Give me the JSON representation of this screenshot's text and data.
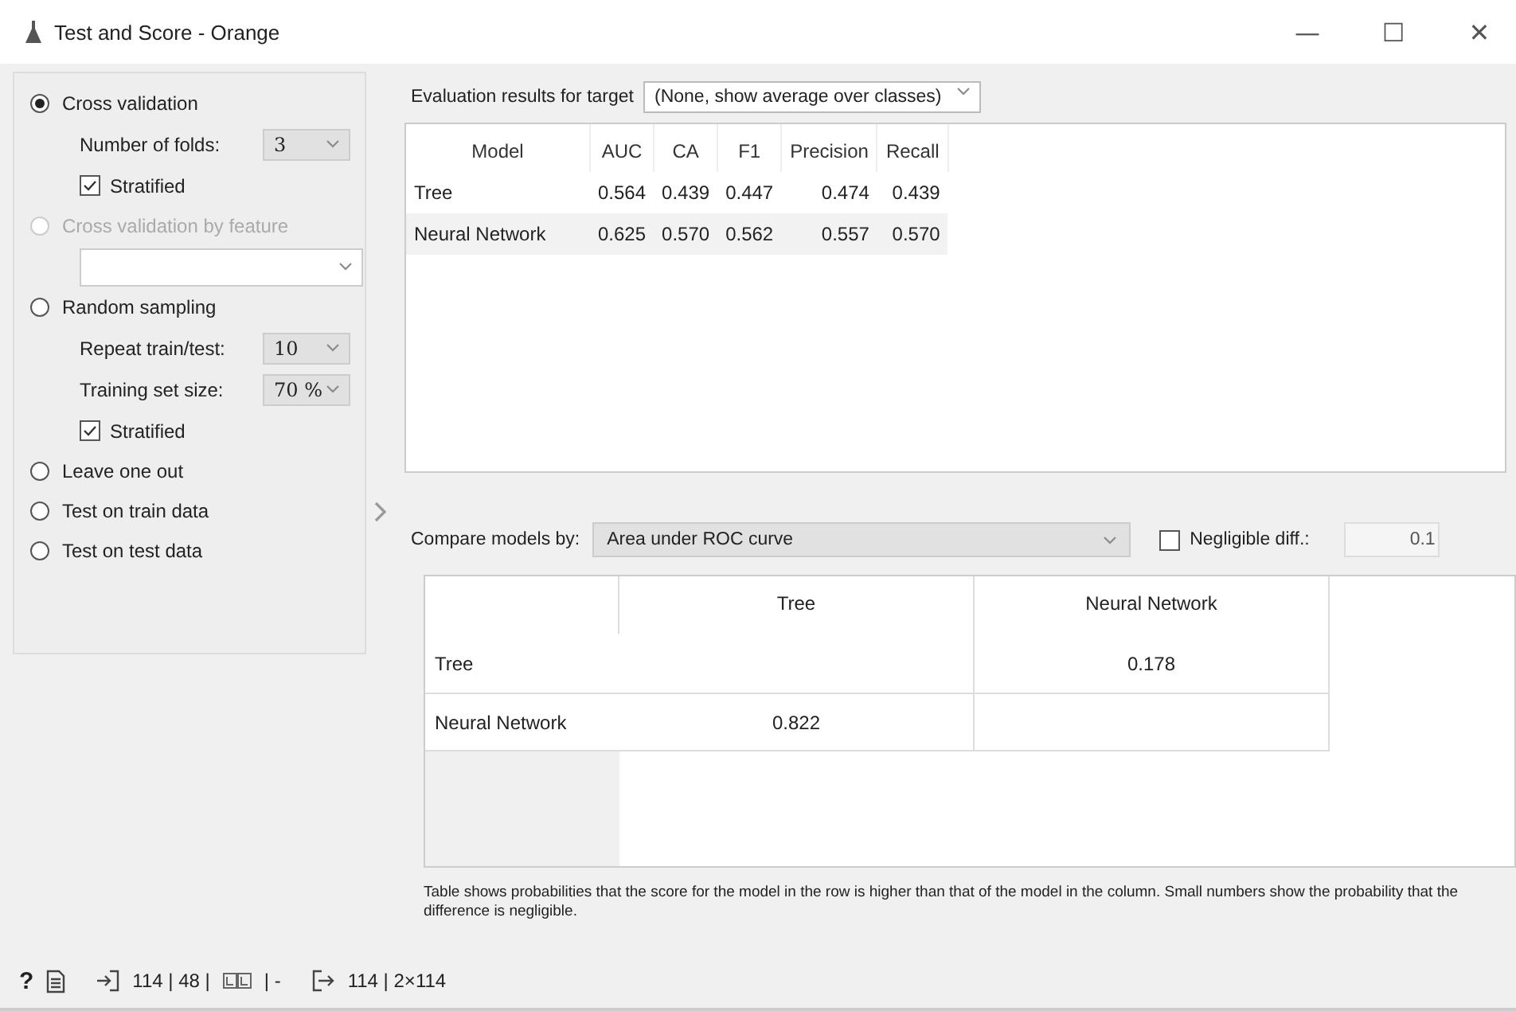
{
  "window": {
    "title": "Test and Score - Orange",
    "controls": [
      "—",
      "☐",
      "✕"
    ]
  },
  "sampling": [
    {
      "kind": "radio",
      "label": "Cross validation",
      "selected": true,
      "disabled": false,
      "settings": [
        {
          "kind": "select",
          "label": "Number of folds:",
          "value": "3"
        },
        {
          "kind": "checkbox",
          "label": "Stratified",
          "checked": true
        }
      ]
    },
    {
      "kind": "radio",
      "label": "Cross validation by feature",
      "selected": false,
      "disabled": true,
      "settings": [
        {
          "kind": "select"
        }
      ]
    },
    {
      "kind": "radio",
      "label": "Random sampling",
      "selected": false,
      "disabled": false,
      "settings": [
        {
          "kind": "select",
          "label": "Repeat train/test:",
          "value": "10"
        },
        {
          "kind": "select",
          "label": "Training set size:",
          "value": "70 %"
        },
        {
          "kind": "checkbox",
          "label": "Stratified",
          "checked": true
        }
      ]
    },
    {
      "kind": "radio",
      "label": "Leave one out",
      "selected": false,
      "disabled": false
    },
    {
      "kind": "radio",
      "label": "Test on train data",
      "selected": false,
      "disabled": false
    },
    {
      "kind": "radio",
      "label": "Test on test data",
      "selected": false,
      "disabled": false
    }
  ],
  "evaluation": {
    "label": "Evaluation results for target",
    "target": "(None, show average over classes)",
    "columns": [
      "Model",
      "AUC",
      "CA",
      "F1",
      "Precision",
      "Recall"
    ],
    "rows": [
      [
        "Tree",
        "0.564",
        "0.439",
        "0.447",
        "0.474",
        "0.439"
      ],
      [
        "Neural Network",
        "0.625",
        "0.570",
        "0.562",
        "0.557",
        "0.570"
      ]
    ]
  },
  "comparison": {
    "label": "Compare models by:",
    "metric": "Area under ROC curve",
    "negligible": {
      "label": "Negligible diff.:",
      "checked": false,
      "value": "0.1",
      "disabled": true
    },
    "columns": [
      "Tree",
      "Neural Network"
    ],
    "rows": [
      {
        "name": "Tree",
        "cells": [
          "",
          "0.178"
        ]
      },
      {
        "name": "Neural Network",
        "cells": [
          "0.822",
          ""
        ]
      }
    ],
    "note": "Table shows probabilities that the score for the model in the row is higher than that of the model in the column. Small numbers show the probability that the difference is negligible."
  },
  "status_bar": {
    "help": "?",
    "input": "114 | 48 |",
    "input_tail": "| -",
    "output": "114 | 2×114"
  }
}
